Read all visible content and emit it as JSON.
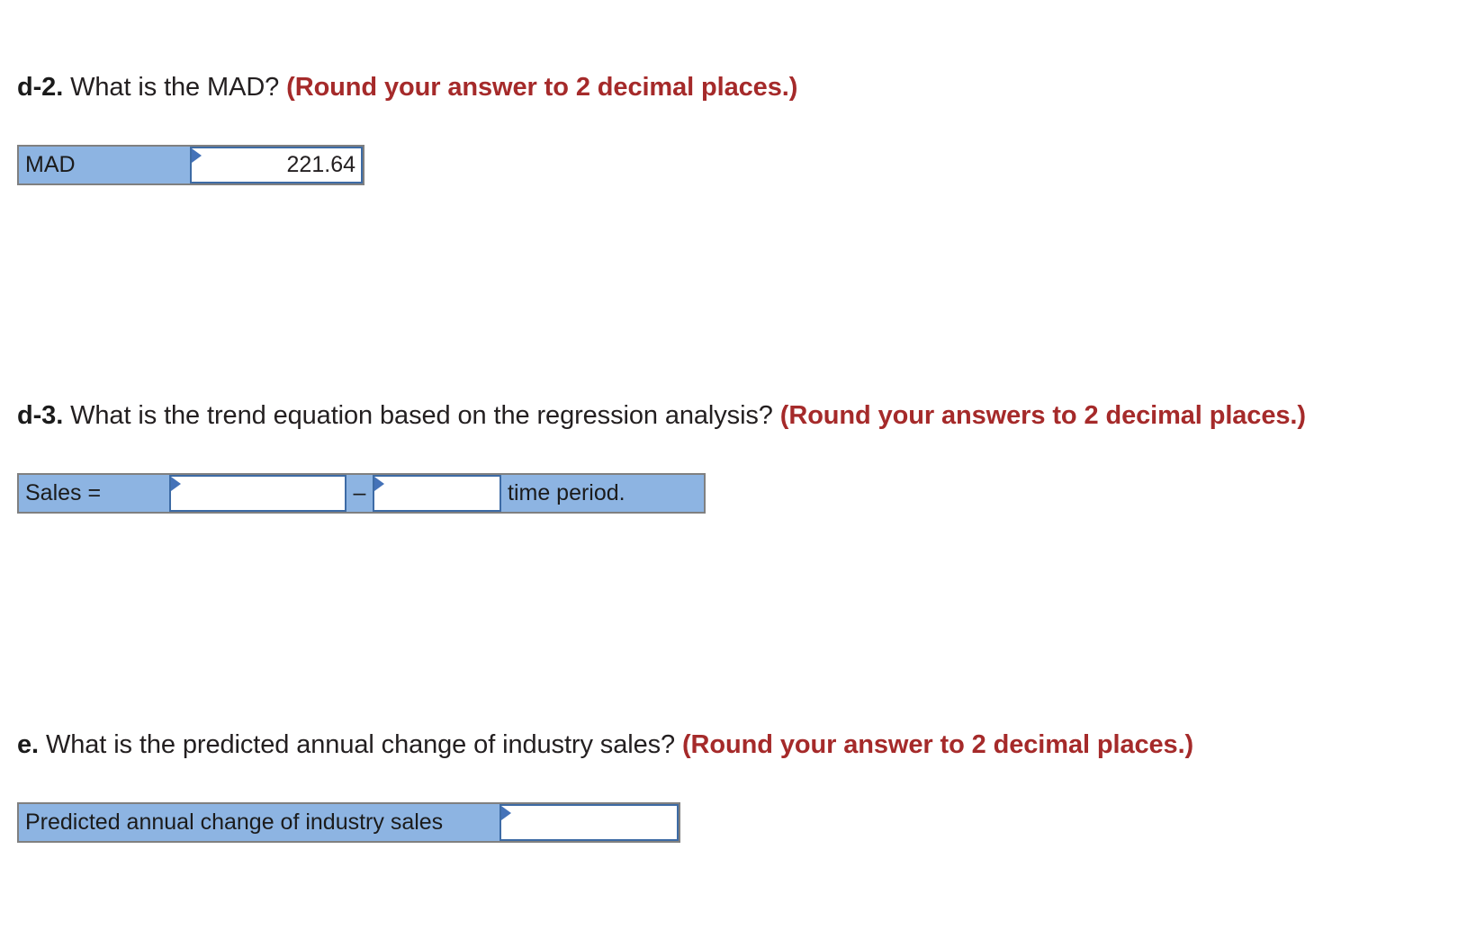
{
  "questions": {
    "d2": {
      "label": "d-2.",
      "text": " What is the MAD? ",
      "note": "(Round your answer to 2 decimal places.)"
    },
    "d3": {
      "label": "d-3.",
      "text": " What is the trend equation based on the regression analysis? ",
      "note": "(Round your answers to 2 decimal places.)"
    },
    "e": {
      "label": "e.",
      "text": " What is the predicted annual change of industry sales? ",
      "note": "(Round your answer to 2 decimal places.)"
    }
  },
  "answers": {
    "mad": {
      "row_label": "MAD",
      "value": "221.64",
      "placeholder": ""
    },
    "trend_equation": {
      "row_label": "Sales =",
      "intercept": "",
      "operator": "–",
      "slope": "",
      "suffix": "time period.",
      "placeholder": ""
    },
    "predicted_change": {
      "row_label": "Predicted annual change of industry sales",
      "value": "",
      "placeholder": ""
    }
  },
  "colors": {
    "cell_fill": "#8db4e2",
    "table_border": "#808080",
    "input_border": "#3d6ba5",
    "marker": "#4472b8",
    "note_text": "#a52a2a",
    "body_text": "#231f20",
    "page_background": "#ffffff"
  },
  "icons": {
    "answer_marker": "triangle-right-marker-icon"
  }
}
